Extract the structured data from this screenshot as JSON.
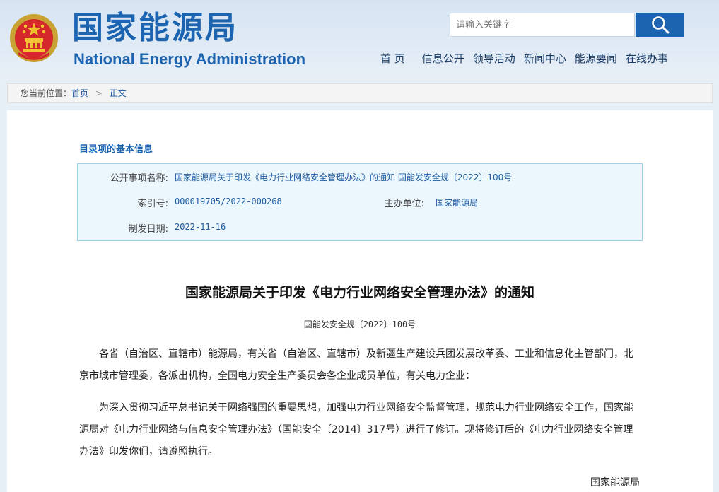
{
  "header": {
    "title_cn": "国家能源局",
    "title_en": "National Energy Administration",
    "emblem_icon": "national-emblem-icon",
    "search": {
      "placeholder": "请输入关键字",
      "button_icon": "search-icon"
    },
    "nav": [
      "首 页",
      "信息公开",
      "领导活动",
      "新闻中心",
      "能源要闻",
      "在线办事"
    ]
  },
  "breadcrumb": {
    "prefix": "您当前位置：",
    "home": "首页",
    "separator": ">",
    "current": "正文"
  },
  "catalog": {
    "section_title": "目录项的基本信息",
    "item_name_label": "公开事项名称:",
    "item_name_value": "国家能源局关于印发《电力行业网络安全管理办法》的通知 国能发安全规〔2022〕100号",
    "index_label": "索引号:",
    "index_value": "000019705/2022-000268",
    "org_label": "主办单位:",
    "org_value": "国家能源局",
    "date_label": "制发日期:",
    "date_value": "2022-11-16"
  },
  "document": {
    "title": "国家能源局关于印发《电力行业网络安全管理办法》的通知",
    "doc_number": "国能发安全规〔2022〕100号",
    "paragraph1": "各省（自治区、直辖市）能源局，有关省（自治区、直辖市）及新疆生产建设兵团发展改革委、工业和信息化主管部门，北京市城市管理委，各派出机构，全国电力安全生产委员会各企业成员单位，有关电力企业：",
    "paragraph2": "为深入贯彻习近平总书记关于网络强国的重要思想，加强电力行业网络安全监督管理，规范电力行业网络安全工作，国家能源局对《电力行业网络与信息安全管理办法》（国能安全〔2014〕317号）进行了修订。现将修订后的《电力行业网络安全管理办法》印发你们，请遵照执行。",
    "signature": "国家能源局"
  },
  "colors": {
    "brand_blue": "#1c63b0",
    "info_box_bg": "#ebf6fd",
    "info_box_border": "#9dd0ea"
  }
}
